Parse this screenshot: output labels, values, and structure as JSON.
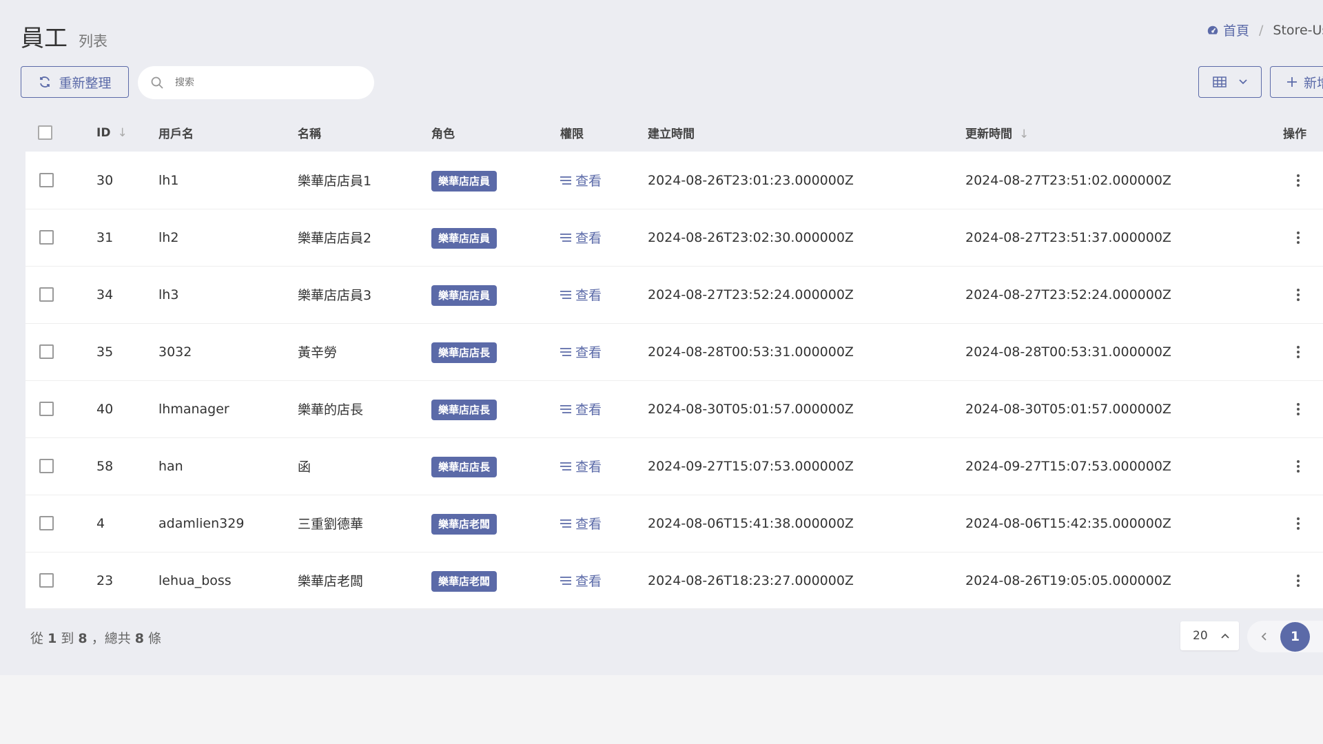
{
  "header": {
    "title": "員工",
    "subtitle": "列表"
  },
  "breadcrumb": {
    "home": "首頁",
    "separator": "/",
    "current": "Store-Use"
  },
  "toolbar": {
    "refresh_label": "重新整理",
    "search_placeholder": "搜索",
    "new_label": "新增"
  },
  "table": {
    "columns": {
      "id": "ID",
      "username": "用戶名",
      "name": "名稱",
      "role": "角色",
      "permission": "權限",
      "created": "建立時間",
      "updated": "更新時間",
      "actions": "操作"
    },
    "rows": [
      {
        "id": "30",
        "username": "lh1",
        "name": "樂華店店員1",
        "role": "樂華店店員",
        "permission": "查看",
        "created": "2024-08-26T23:01:23.000000Z",
        "updated": "2024-08-27T23:51:02.000000Z"
      },
      {
        "id": "31",
        "username": "lh2",
        "name": "樂華店店員2",
        "role": "樂華店店員",
        "permission": "查看",
        "created": "2024-08-26T23:02:30.000000Z",
        "updated": "2024-08-27T23:51:37.000000Z"
      },
      {
        "id": "34",
        "username": "lh3",
        "name": "樂華店店員3",
        "role": "樂華店店員",
        "permission": "查看",
        "created": "2024-08-27T23:52:24.000000Z",
        "updated": "2024-08-27T23:52:24.000000Z"
      },
      {
        "id": "35",
        "username": "3032",
        "name": "黃辛勞",
        "role": "樂華店店長",
        "permission": "查看",
        "created": "2024-08-28T00:53:31.000000Z",
        "updated": "2024-08-28T00:53:31.000000Z"
      },
      {
        "id": "40",
        "username": "lhmanager",
        "name": "樂華的店長",
        "role": "樂華店店長",
        "permission": "查看",
        "created": "2024-08-30T05:01:57.000000Z",
        "updated": "2024-08-30T05:01:57.000000Z"
      },
      {
        "id": "58",
        "username": "han",
        "name": "函",
        "role": "樂華店店長",
        "permission": "查看",
        "created": "2024-09-27T15:07:53.000000Z",
        "updated": "2024-09-27T15:07:53.000000Z"
      },
      {
        "id": "4",
        "username": "adamlien329",
        "name": "三重劉德華",
        "role": "樂華店老闆",
        "permission": "查看",
        "created": "2024-08-06T15:41:38.000000Z",
        "updated": "2024-08-06T15:42:35.000000Z"
      },
      {
        "id": "23",
        "username": "lehua_boss",
        "name": "樂華店老闆",
        "role": "樂華店老闆",
        "permission": "查看",
        "created": "2024-08-26T18:23:27.000000Z",
        "updated": "2024-08-26T19:05:05.000000Z"
      }
    ]
  },
  "footer": {
    "prefix": "從",
    "from": "1",
    "to_word": "到",
    "to": "8",
    "total_word": "，總共",
    "total": "8",
    "suffix": "條",
    "per_page": "20",
    "current_page": "1"
  },
  "colors": {
    "accent": "#5b6aa8",
    "background": "#ecedf2"
  }
}
